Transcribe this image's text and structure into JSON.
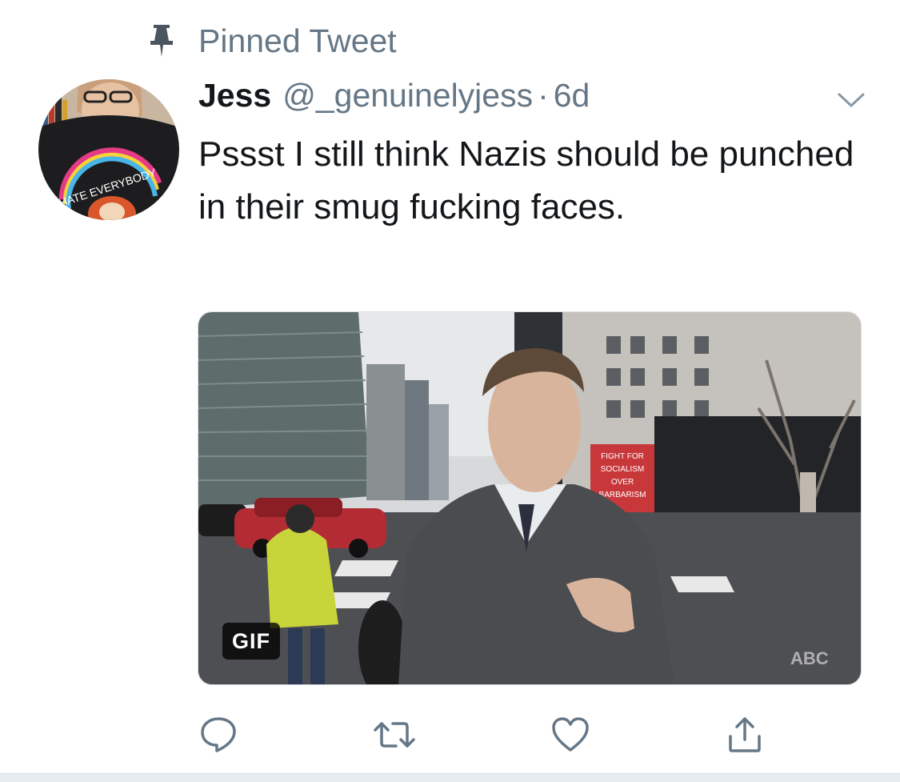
{
  "pinned": {
    "label": "Pinned Tweet",
    "icon": "pin-icon"
  },
  "tweet": {
    "author_name": "Jess",
    "handle": "@_genuinelyjess",
    "separator": "·",
    "time": "6d",
    "text": "Pssst I still think Nazis should be punched in their smug fucking faces.",
    "media": {
      "badge": "GIF",
      "sign_text": [
        "FIGHT FOR",
        "SOCIALISM",
        "OVER",
        "BARBARISM"
      ],
      "shirt_text": "HATE EVERYBODY",
      "watermark": "ABC"
    }
  },
  "actions": [
    {
      "name": "reply-icon"
    },
    {
      "name": "retweet-icon"
    },
    {
      "name": "like-icon"
    },
    {
      "name": "share-icon"
    }
  ],
  "colors": {
    "text": "#14171a",
    "muted": "#657786",
    "icon": "#657786",
    "divider": "#e6ecf0"
  }
}
